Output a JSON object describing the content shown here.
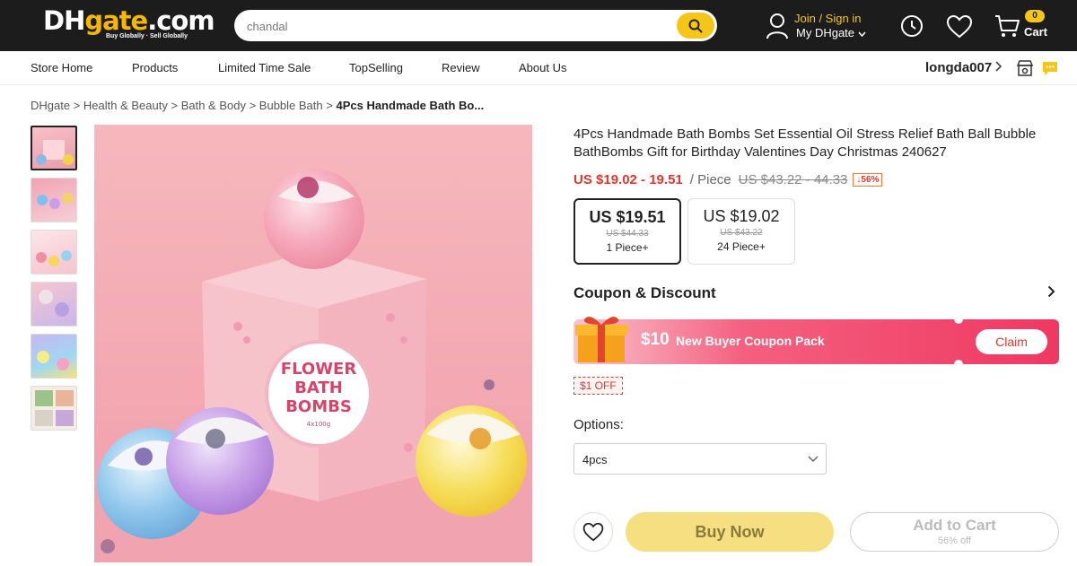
{
  "header": {
    "logo_main": "DHgate.com",
    "logo_tagline": "Buy Globally · Sell Globally",
    "search_value": "chandal",
    "account_join": "Join / Sign in",
    "account_my": "My DHgate",
    "cart_count": "0",
    "cart_label": "Cart",
    "accent_color": "#f5c518"
  },
  "nav": {
    "items": [
      "Store Home",
      "Products",
      "Limited Time Sale",
      "TopSelling",
      "Review",
      "About Us"
    ],
    "store_name": "longda007"
  },
  "breadcrumb": {
    "items": [
      "DHgate",
      "Health & Beauty",
      "Bath & Body",
      "Bubble Bath"
    ],
    "current": "4Pcs Handmade Bath Bo..."
  },
  "product": {
    "title": "4Pcs Handmade Bath Bombs Set Essential Oil Stress Relief Bath Ball Bubble BathBombs Gift for Birthday Valentines Day Christmas 240627",
    "price_range": "US $19.02 - 19.51",
    "unit": "/ Piece",
    "original_range": "US $43.22 - 44.33",
    "discount": "↓56%",
    "box_label_1": "FLOWER",
    "box_label_2": "BATH",
    "box_label_3": "BOMBS",
    "box_weight": "4x100g",
    "tiers": [
      {
        "price": "US $19.51",
        "original": "US $44.33",
        "qty": "1 Piece+"
      },
      {
        "price": "US $19.02",
        "original": "US $43.22",
        "qty": "24 Piece+"
      }
    ]
  },
  "coupon": {
    "heading": "Coupon & Discount",
    "amount": "$10",
    "text": "New Buyer Coupon Pack",
    "claim": "Claim",
    "off_tag": "$1 OFF"
  },
  "options": {
    "label": "Options:",
    "selected": "4pcs"
  },
  "actions": {
    "buy_now": "Buy Now",
    "add_to_cart": "Add to Cart",
    "add_to_cart_sub": "56% off"
  }
}
